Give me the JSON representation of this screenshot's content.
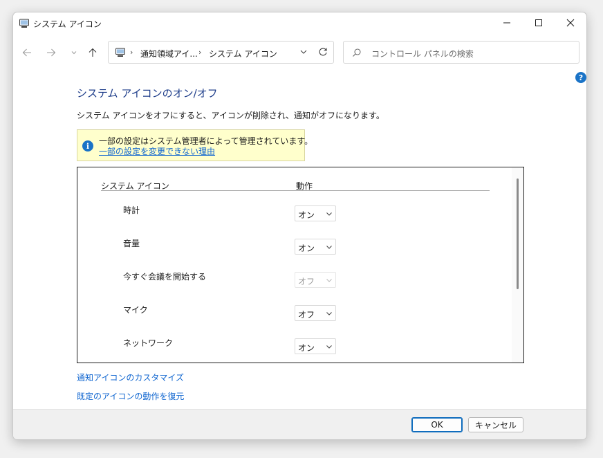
{
  "window": {
    "title": "システム アイコン",
    "minimize_glyph": "—",
    "maximize_glyph": "☐",
    "close_glyph": "✕"
  },
  "nav": {
    "breadcrumb": [
      "通知領域アイ...",
      "システム アイコン"
    ],
    "crumb_separator": "›",
    "search_placeholder": "コントロール パネルの検索"
  },
  "help": {
    "glyph": "?"
  },
  "page": {
    "title": "システム アイコンのオン/オフ",
    "description": "システム アイコンをオフにすると、アイコンが削除され、通知がオフになります。"
  },
  "notice": {
    "icon_glyph": "i",
    "message": "一部の設定はシステム管理者によって管理されています。",
    "link": "一部の設定を変更できない理由"
  },
  "table": {
    "col_icon": "システム アイコン",
    "col_action": "動作",
    "rows": [
      {
        "label": "時計",
        "value": "オン",
        "disabled": false
      },
      {
        "label": "音量",
        "value": "オン",
        "disabled": false
      },
      {
        "label": "今すぐ会議を開始する",
        "value": "オフ",
        "disabled": true
      },
      {
        "label": "マイク",
        "value": "オフ",
        "disabled": false
      },
      {
        "label": "ネットワーク",
        "value": "オン",
        "disabled": false
      }
    ]
  },
  "links": {
    "customize": "通知アイコンのカスタマイズ",
    "restore": "既定のアイコンの動作を復元"
  },
  "buttons": {
    "ok": "OK",
    "cancel": "キャンセル"
  },
  "colors": {
    "accent": "#1a73c7",
    "link": "#1066d0",
    "title": "#1e3d8a",
    "notice_bg": "#ffffcc"
  }
}
